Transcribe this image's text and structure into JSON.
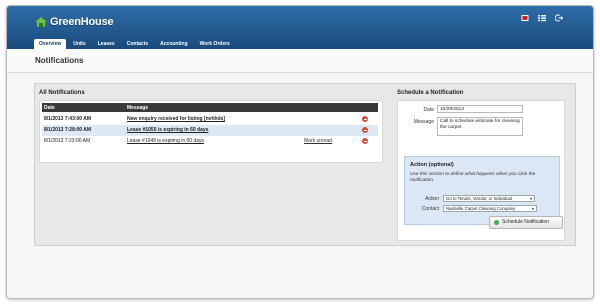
{
  "app": {
    "name": "GreenHouse"
  },
  "tabs": [
    {
      "label": "Overview",
      "active": true
    },
    {
      "label": "Units"
    },
    {
      "label": "Leases"
    },
    {
      "label": "Contacts"
    },
    {
      "label": "Accounting"
    },
    {
      "label": "Work Orders"
    }
  ],
  "page": {
    "title": "Notifications"
  },
  "notifications": {
    "title": "All Notifications",
    "columns": [
      "Date",
      "Message"
    ],
    "rows": [
      {
        "date": "8/1/2013 7:43:00 AM",
        "message": "New enquiry received for listing [nvhhds]",
        "unread": true
      },
      {
        "date": "8/1/2013 7:28:00 AM",
        "message": "Lease #1050 is expiring in 60 days",
        "unread": true
      },
      {
        "date": "8/1/2013 7:23:00 AM",
        "message": "Lease #1049 is expiring in 60 days",
        "unread": false,
        "mark_label": "Mark unread"
      }
    ]
  },
  "schedule": {
    "title": "Schedule a Notification",
    "date_label": "Date",
    "date_value": "10/29/2013",
    "message_label": "Message",
    "message_value": "Call to schedule estimate for cleaning the carpet",
    "action": {
      "title": "Action (optional)",
      "note": "Use this section to define what happens when you click the notification.",
      "action_label": "Action",
      "action_value": "Go to Tenant, Vendor, or Individual",
      "contact_label": "Contact",
      "contact_value": "Nashville Carpet Cleaning Company"
    },
    "button_label": "Schedule Notification"
  },
  "colors": {
    "header": "#245b91",
    "accent": "#49a74a",
    "alert": "#d64a3a"
  },
  "icons": [
    "flag-icon",
    "list-icon",
    "logout-icon",
    "delete-icon",
    "check-icon"
  ]
}
